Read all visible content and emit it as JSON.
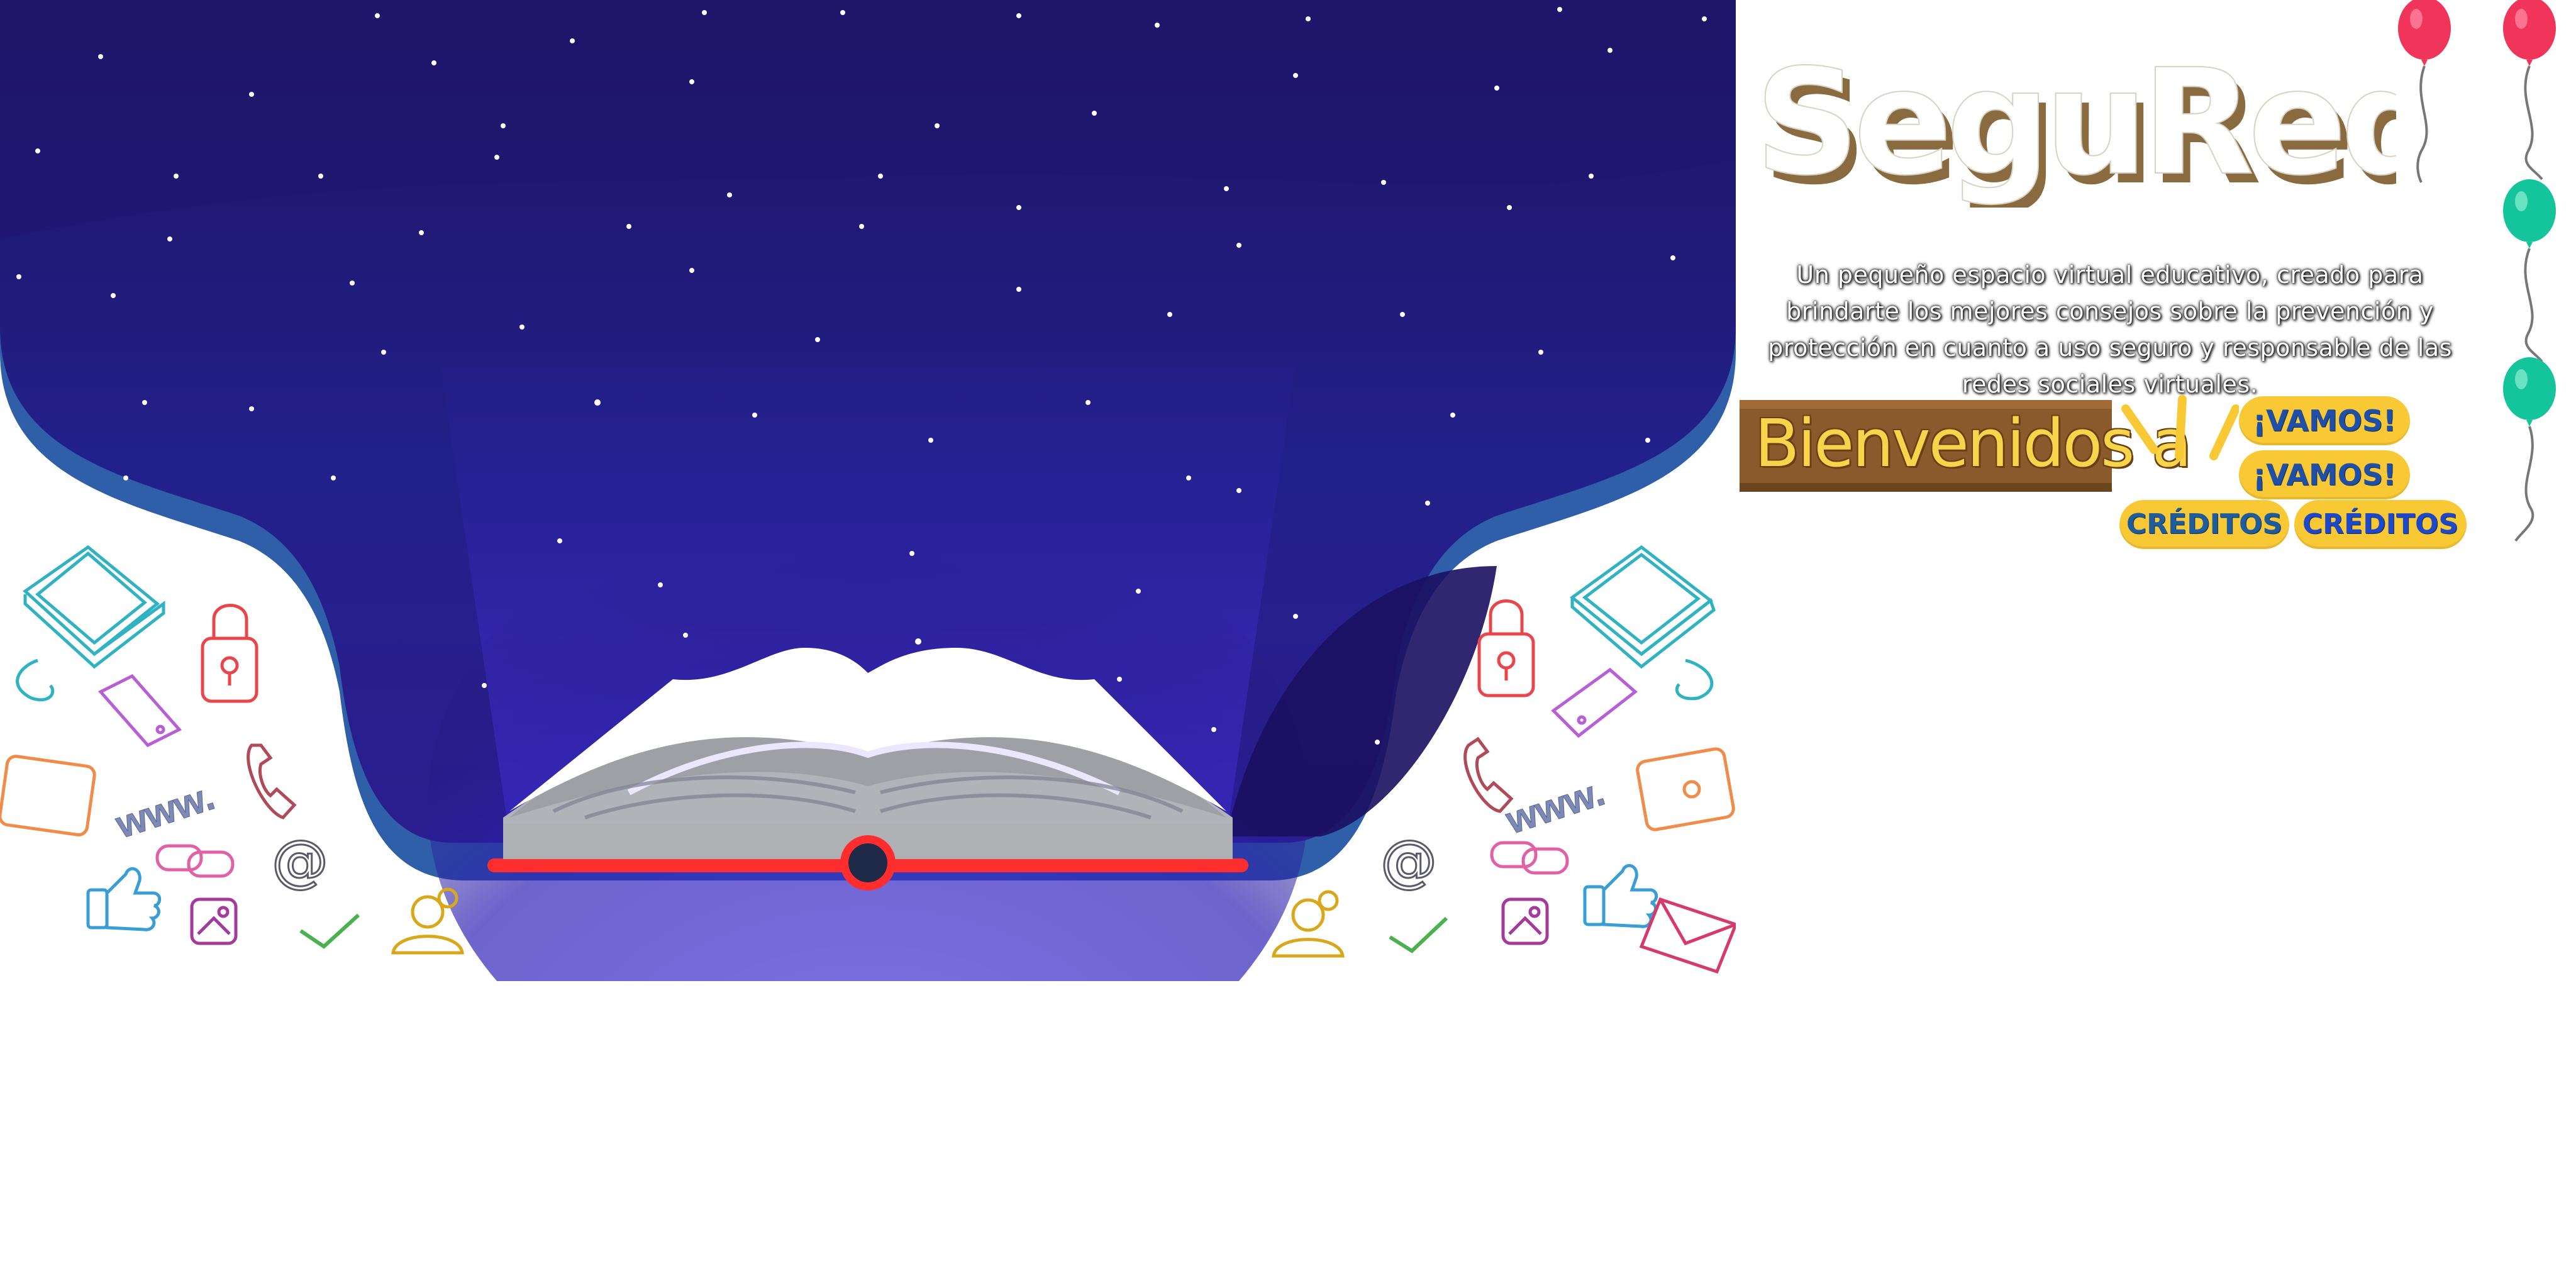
{
  "site": {
    "title": "SeguRedes",
    "tagline": "Un pequeño espacio virtual educativo, creado para brindarte los mejores consejos sobre la prevención y protección en cuanto a uso seguro y responsable de las redes sociales virtuales.",
    "welcome_label": "Bienvenidos a"
  },
  "buttons": {
    "vamos_1": "¡VAMOS!",
    "vamos_2": "¡VAMOS!",
    "creditos_1": "CRÉDITOS",
    "creditos_2": "CRÉDITOS"
  },
  "doodles": {
    "www_text": "www.",
    "at_symbol": "@"
  },
  "colors": {
    "night_sky_top": "#1e1463",
    "night_sky_bottom": "#3b2cd6",
    "curtain_edge": "#2f5fa8",
    "book_spine": "#ff2e2e",
    "button_yellow": "#f9c935",
    "button_text_blue": "#1f4fa6",
    "balloon_red": "#f0345a",
    "balloon_green": "#14c49a",
    "sign_brown": "#8a5a2c"
  },
  "icons": [
    "laptop-icon",
    "padlock-icon",
    "smartphone-icon",
    "tablet-icon",
    "telephone-icon",
    "link-icon",
    "at-icon",
    "thumbs-up-icon",
    "photo-icon",
    "checkmark-icon",
    "user-icon",
    "envelope-icon",
    "balloon-icon"
  ]
}
